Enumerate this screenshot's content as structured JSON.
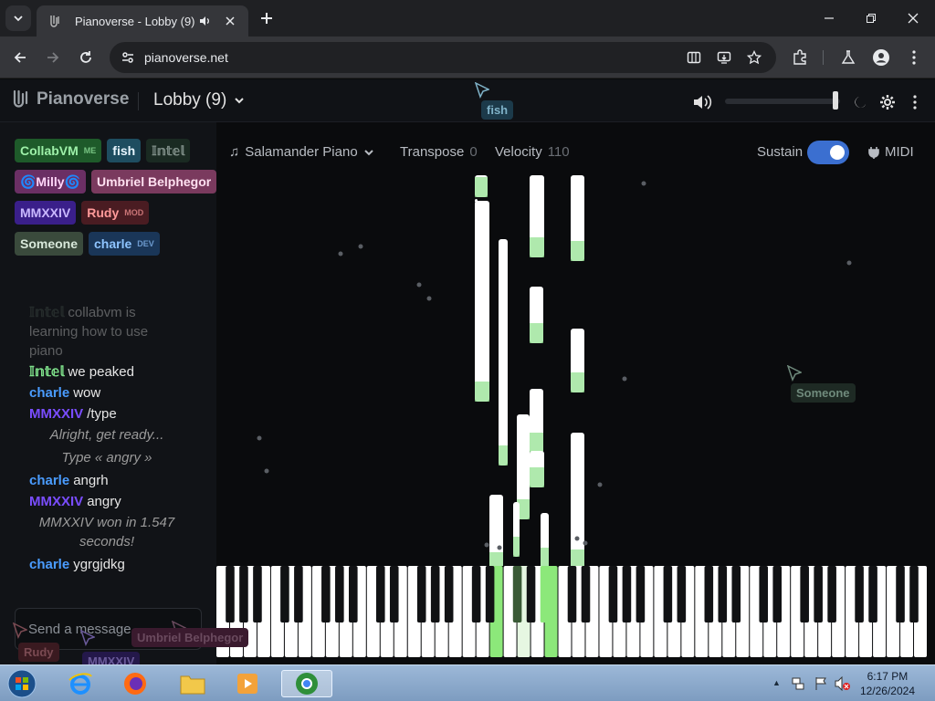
{
  "browser": {
    "tab_title": "Pianoverse - Lobby (9)",
    "url": "pianoverse.net"
  },
  "app": {
    "brand": "Pianoverse",
    "room": "Lobby (9)"
  },
  "users": [
    {
      "name": "CollabVM",
      "badge": "ME",
      "bg": "#1e5a2a",
      "fg": "#9df0a8"
    },
    {
      "name": "fish",
      "badge": "",
      "bg": "#1e4d60",
      "fg": "#e8f6ff"
    },
    {
      "name": "𝕀𝕟𝕥𝕖𝕝",
      "badge": "",
      "bg": "#1a2a22",
      "fg": "#7d8c86"
    },
    {
      "name": "🌀Milly🌀",
      "badge": "",
      "bg": "#6b2f64",
      "fg": "#ffd6f8"
    },
    {
      "name": "Umbriel Belphegor",
      "badge": "",
      "bg": "#7a3a5e",
      "fg": "#ffe0f0"
    },
    {
      "name": "MMXXIV",
      "badge": "",
      "bg": "#3a1f8a",
      "fg": "#c9b8ff"
    },
    {
      "name": "Rudy",
      "badge": "MOD",
      "bg": "#4a1c22",
      "fg": "#ff9a9a"
    },
    {
      "name": "Someone",
      "badge": "",
      "bg": "#3a4a3c",
      "fg": "#d8e8da"
    },
    {
      "name": "charle",
      "badge": "DEV",
      "bg": "#1a3658",
      "fg": "#8ec4ff"
    }
  ],
  "chat": [
    {
      "kind": "msg",
      "name": "𝕀𝕟𝕥𝕖𝕝",
      "color": "#4a5a52",
      "text": "collabvm is learning how to use piano",
      "dim": true
    },
    {
      "kind": "msg",
      "name": "𝕀𝕟𝕥𝕖𝕝",
      "color": "#7ee08a",
      "text": "we peaked"
    },
    {
      "kind": "msg",
      "name": "charle",
      "color": "#4a9cff",
      "text": "wow"
    },
    {
      "kind": "msg",
      "name": "MMXXIV",
      "color": "#7a4dff",
      "text": "/type"
    },
    {
      "kind": "sys",
      "text": "Alright, get ready..."
    },
    {
      "kind": "sys",
      "text": "Type « angry »"
    },
    {
      "kind": "msg",
      "name": "charle",
      "color": "#4a9cff",
      "text": "angrh"
    },
    {
      "kind": "msg",
      "name": "MMXXIV",
      "color": "#7a4dff",
      "text": "angry"
    },
    {
      "kind": "sys",
      "text": "MMXXIV won in 1.547 seconds!"
    },
    {
      "kind": "msg",
      "name": "charle",
      "color": "#4a9cff",
      "text": "ygrgjdkg"
    }
  ],
  "input": {
    "placeholder": "Send a message..."
  },
  "controls": {
    "instrument": "Salamander Piano",
    "transpose_label": "Transpose",
    "transpose_value": "0",
    "velocity_label": "Velocity",
    "velocity_value": "110",
    "sustain_label": "Sustain",
    "sustain_on": true,
    "midi_label": "MIDI"
  },
  "volume": {
    "level": 0.95
  },
  "cursors": [
    {
      "name": "fish"
    },
    {
      "name": "Someone"
    },
    {
      "name": "Umbriel Belphegor"
    },
    {
      "name": "Rudy"
    },
    {
      "name": "MMXXIV"
    }
  ],
  "taskbar": {
    "time": "6:17 PM",
    "date": "12/26/2024"
  },
  "colors": {
    "note": "#ffffff",
    "note_glow": "#8de08a",
    "pressed_key": "#8ce87a",
    "sustain": "#3b6fd0"
  }
}
